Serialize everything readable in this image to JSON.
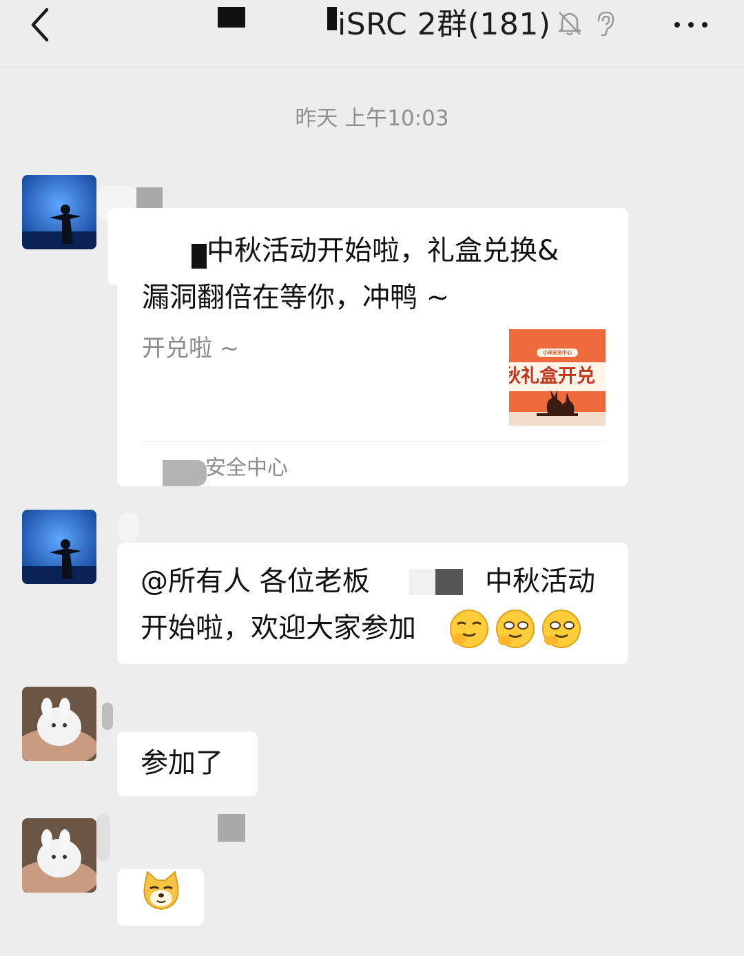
{
  "header": {
    "title": "iSRC 2群(181)",
    "back_icon": "chevron-left-icon",
    "mute_icon": "bell-off-icon",
    "ear_icon": "ear-icon",
    "more_icon": "more-icon"
  },
  "timestamp": "昨天 上午10:03",
  "messages": [
    {
      "type": "card",
      "title_line1": "中秋活动开始啦，礼盒兑换&",
      "title_line2": "漏洞翻倍在等你，冲鸭 ~",
      "subtitle": "开兑啦 ~",
      "thumb_badge": "小米安全中心",
      "thumb_text": "秋礼盒开兑",
      "footer": "安全中心"
    },
    {
      "type": "text",
      "line1_a": "@所有人 各位老板",
      "line1_b": "中秋活动",
      "line2": "开始啦，欢迎大家参加"
    },
    {
      "type": "text",
      "text": "参加了"
    },
    {
      "type": "sticker",
      "sticker_icon": "doge-emoji-icon"
    }
  ],
  "colors": {
    "background": "#ededed",
    "bubble": "#ffffff",
    "timestamp": "#8f8f8f"
  }
}
